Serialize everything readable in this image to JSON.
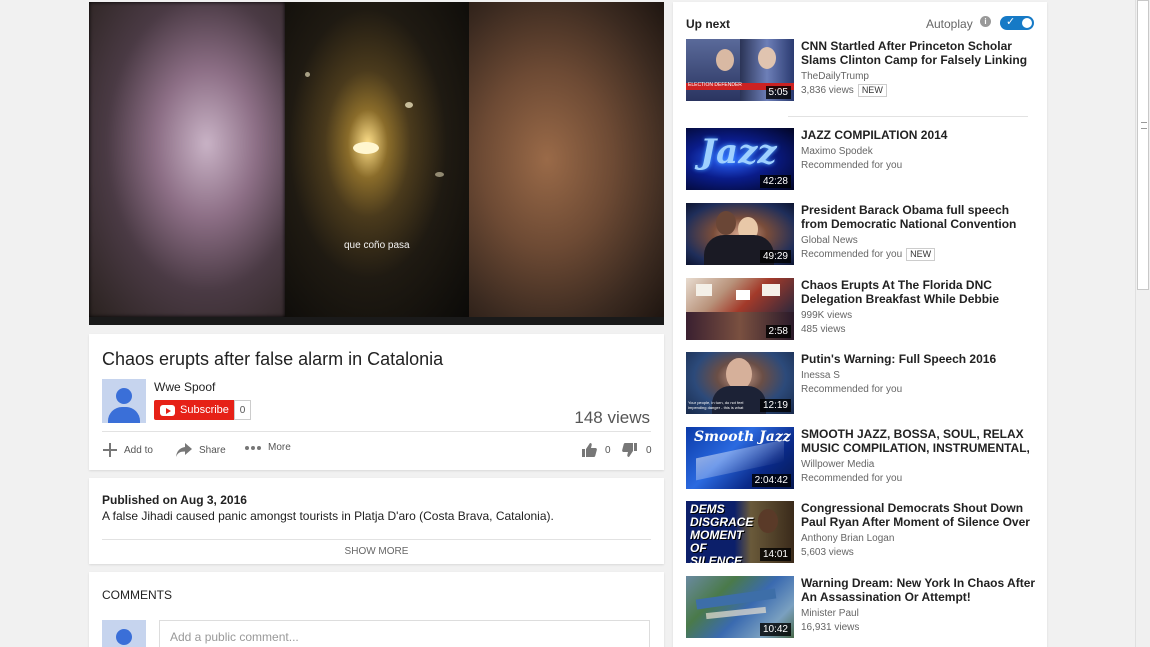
{
  "player": {
    "subtitle": "que coño pasa"
  },
  "video": {
    "title": "Chaos erupts after false alarm in Catalonia",
    "channel": "Wwe Spoof",
    "subscribe_label": "Subscribe",
    "subscriber_count": "0",
    "views": "148 views",
    "actions": {
      "add_to": "Add to",
      "share": "Share",
      "more": "More"
    },
    "likes": "0",
    "dislikes": "0"
  },
  "description": {
    "published": "Published on Aug 3, 2016",
    "text": "A false Jihadi caused panic amongst tourists in Platja D'aro (Costa Brava, Catalonia).",
    "show_more": "SHOW MORE"
  },
  "comments": {
    "title": "COMMENTS",
    "placeholder": "Add a public comment..."
  },
  "sidebar": {
    "up_next": "Up next",
    "autoplay": "Autoplay",
    "info_glyph": "i",
    "toggle_glyph": "✓",
    "items": [
      {
        "title": "CNN Startled After Princeton Scholar Slams Clinton Camp for Falsely Linking Trump to",
        "line1": "TheDailyTrump",
        "line2": "3,836 views",
        "badge": "NEW",
        "duration": "5:05",
        "thumb_text": "ELECTION DEFENDER",
        "icon": "news-panel-thumbnail"
      },
      {
        "title": "JAZZ COMPILATION 2014",
        "line1": "Maximo Spodek",
        "line2": "Recommended for you",
        "badge": "",
        "duration": "42:28",
        "thumb_text": "Jazz",
        "icon": "jazz-neon-thumbnail"
      },
      {
        "title": "President Barack Obama full speech from Democratic National Convention",
        "line1": "Global News",
        "line2": "Recommended for you",
        "badge": "NEW",
        "duration": "49:29",
        "thumb_text": "",
        "icon": "speech-hug-thumbnail"
      },
      {
        "title": "Chaos Erupts At The Florida DNC Delegation Breakfast While Debbie Wasserman Schultz",
        "line1": "999K views",
        "line2": "485 views",
        "badge": "",
        "duration": "2:58",
        "thumb_text": "",
        "icon": "crowd-signs-thumbnail"
      },
      {
        "title": "Putin's Warning: Full Speech 2016",
        "line1": "Inessa S",
        "line2": "Recommended for you",
        "badge": "",
        "duration": "12:19",
        "thumb_text": "Your people, in turn, do not feel impending danger - this is what",
        "icon": "speaker-portrait-thumbnail"
      },
      {
        "title": "SMOOTH JAZZ, BOSSA, SOUL, RELAX MUSIC COMPILATION, INSTRUMENTAL,",
        "line1": "Willpower Media",
        "line2": "Recommended for you",
        "badge": "",
        "duration": "2:04:42",
        "thumb_text": "Smooth Jazz",
        "icon": "smooth-jazz-thumbnail"
      },
      {
        "title": "Congressional Democrats Shout Down Paul Ryan After Moment of Silence Over Gun",
        "line1": "Anthony Brian Logan",
        "line2": "5,603 views",
        "badge": "",
        "duration": "14:01",
        "thumb_text": "DEMS DISGRACE MOMENT OF SILENCE.",
        "icon": "dems-disgrace-thumbnail"
      },
      {
        "title": "Warning Dream: New York In Chaos After An Assassination Or Attempt!",
        "line1": "Minister Paul",
        "line2": "16,931 views",
        "badge": "",
        "duration": "10:42",
        "thumb_text": "",
        "icon": "satellite-map-thumbnail"
      }
    ]
  },
  "colors": {
    "background": "#f1f1f1",
    "subscribe_red": "#e62117",
    "toggle_blue": "#167ac6",
    "avatar_blue": "#3a6fd8"
  }
}
